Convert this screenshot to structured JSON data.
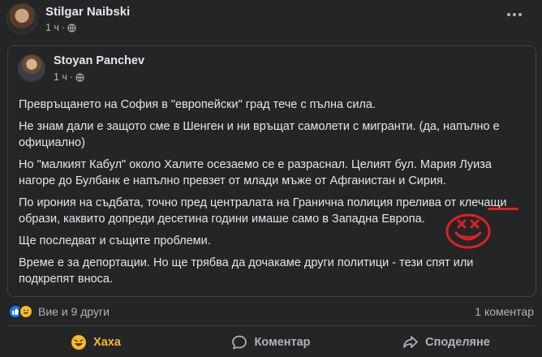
{
  "post": {
    "author": "Stilgar Naibski",
    "time": "1 ч",
    "dot_sep": "·"
  },
  "shared": {
    "author": "Stoyan Panchev",
    "time": "1 ч",
    "dot_sep": "·",
    "paragraphs": [
      "Превръщането на София в \"европейски\" град тече с пълна сила.",
      "Не знам дали е защото сме в Шенген и ни връщат самолети с мигранти. (да, напълно е официално)",
      "Но \"малкият Кабул\" около Халите осезаемо се е разраснал. Целият бул. Мария Луиза нагоре до Булбанк е напълно превзет от млади мъже от Афганистан и Сирия.",
      "По ирония на съдбата, точно пред централата на Гранична полиция прелива от клечащи образи, каквито допреди десетина години имаше само в Западна Европа.",
      "Ще последват и същите проблеми.",
      "Време е за депортации. Но ще трябва да дочакаме други политици - тези спят или подкрепят вноса."
    ]
  },
  "stats": {
    "reactions_text": "Вие и 9 други",
    "comments_text": "1 коментар"
  },
  "actions": {
    "haha_label": "Хаха",
    "comment_label": "Коментар",
    "share_label": "Споделяне"
  },
  "colors": {
    "background": "#242526",
    "haha_active": "#f7b928",
    "like_blue": "#1877f2",
    "annotation_red": "#e02020"
  },
  "icons": {
    "more": "more-options-icon",
    "audience": "globe-icon",
    "like": "like-reaction-icon",
    "haha": "haha-reaction-icon",
    "comment": "comment-icon",
    "share": "share-icon",
    "annotation": "hand-drawn-dead-face-icon"
  }
}
